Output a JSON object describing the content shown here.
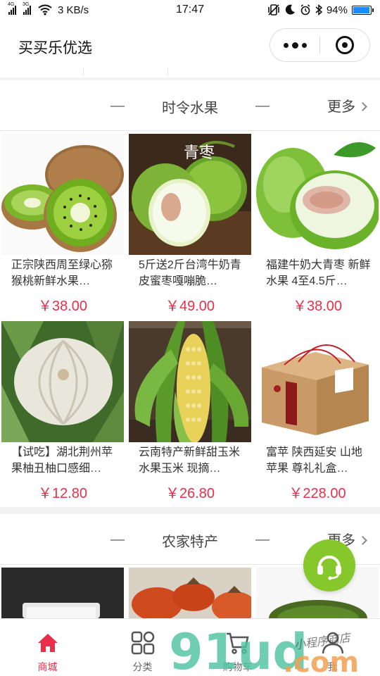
{
  "status_bar": {
    "network_left": "4G",
    "network_right": "3G",
    "speed": "3 KB/s",
    "time": "17:47",
    "battery": "94%",
    "battery_level": 0.94
  },
  "nav": {
    "title": "买买乐优选",
    "menu_icon": "more-dots-icon",
    "close_icon": "target-close-icon"
  },
  "sections": [
    {
      "title": "时令水果",
      "more_label": "更多",
      "products": [
        {
          "name": "正宗陕西周至绿心猕猴桃新鲜水果…",
          "price": "￥38.00",
          "image": "kiwi"
        },
        {
          "name": "5斤送2斤台湾牛奶青皮蜜枣嘎嘣脆…",
          "price": "￥49.00",
          "image": "jujube",
          "image_text": "青枣"
        },
        {
          "name": "福建牛奶大青枣 新鲜水果 4至4.5斤…",
          "price": "￥38.00",
          "image": "green-jujube"
        },
        {
          "name": "【试吃】湖北荆州苹果柚丑柚口感细…",
          "price": "￥12.80",
          "image": "pumpkin-pomelo"
        },
        {
          "name": "云南特产新鲜甜玉米 水果玉米 现摘…",
          "price": "￥26.80",
          "image": "corn"
        },
        {
          "name": "富苹 陕西延安 山地苹果 尊礼礼盒…",
          "price": "￥228.00",
          "image": "apple-gift-box"
        }
      ]
    },
    {
      "title": "农家特产",
      "more_label": "更多",
      "products": [
        {
          "image": "packaged-food"
        },
        {
          "image": "dried-persimmon"
        },
        {
          "image": "mung-beans"
        }
      ]
    }
  ],
  "tabs": [
    {
      "label": "商城",
      "icon": "home-icon",
      "active": true
    },
    {
      "label": "分类",
      "icon": "grid-icon",
      "active": false
    },
    {
      "label": "购物车",
      "icon": "cart-icon",
      "active": false
    },
    {
      "label": "我",
      "icon": "user-icon",
      "active": false
    }
  ],
  "customer_service_icon": "headset-icon",
  "watermark": {
    "main": "91ud",
    "domain": ".com",
    "script": "小程序商店"
  },
  "colors": {
    "accent": "#e8304a",
    "cs_green": "#86c82b",
    "price_red": "#e8304a"
  }
}
